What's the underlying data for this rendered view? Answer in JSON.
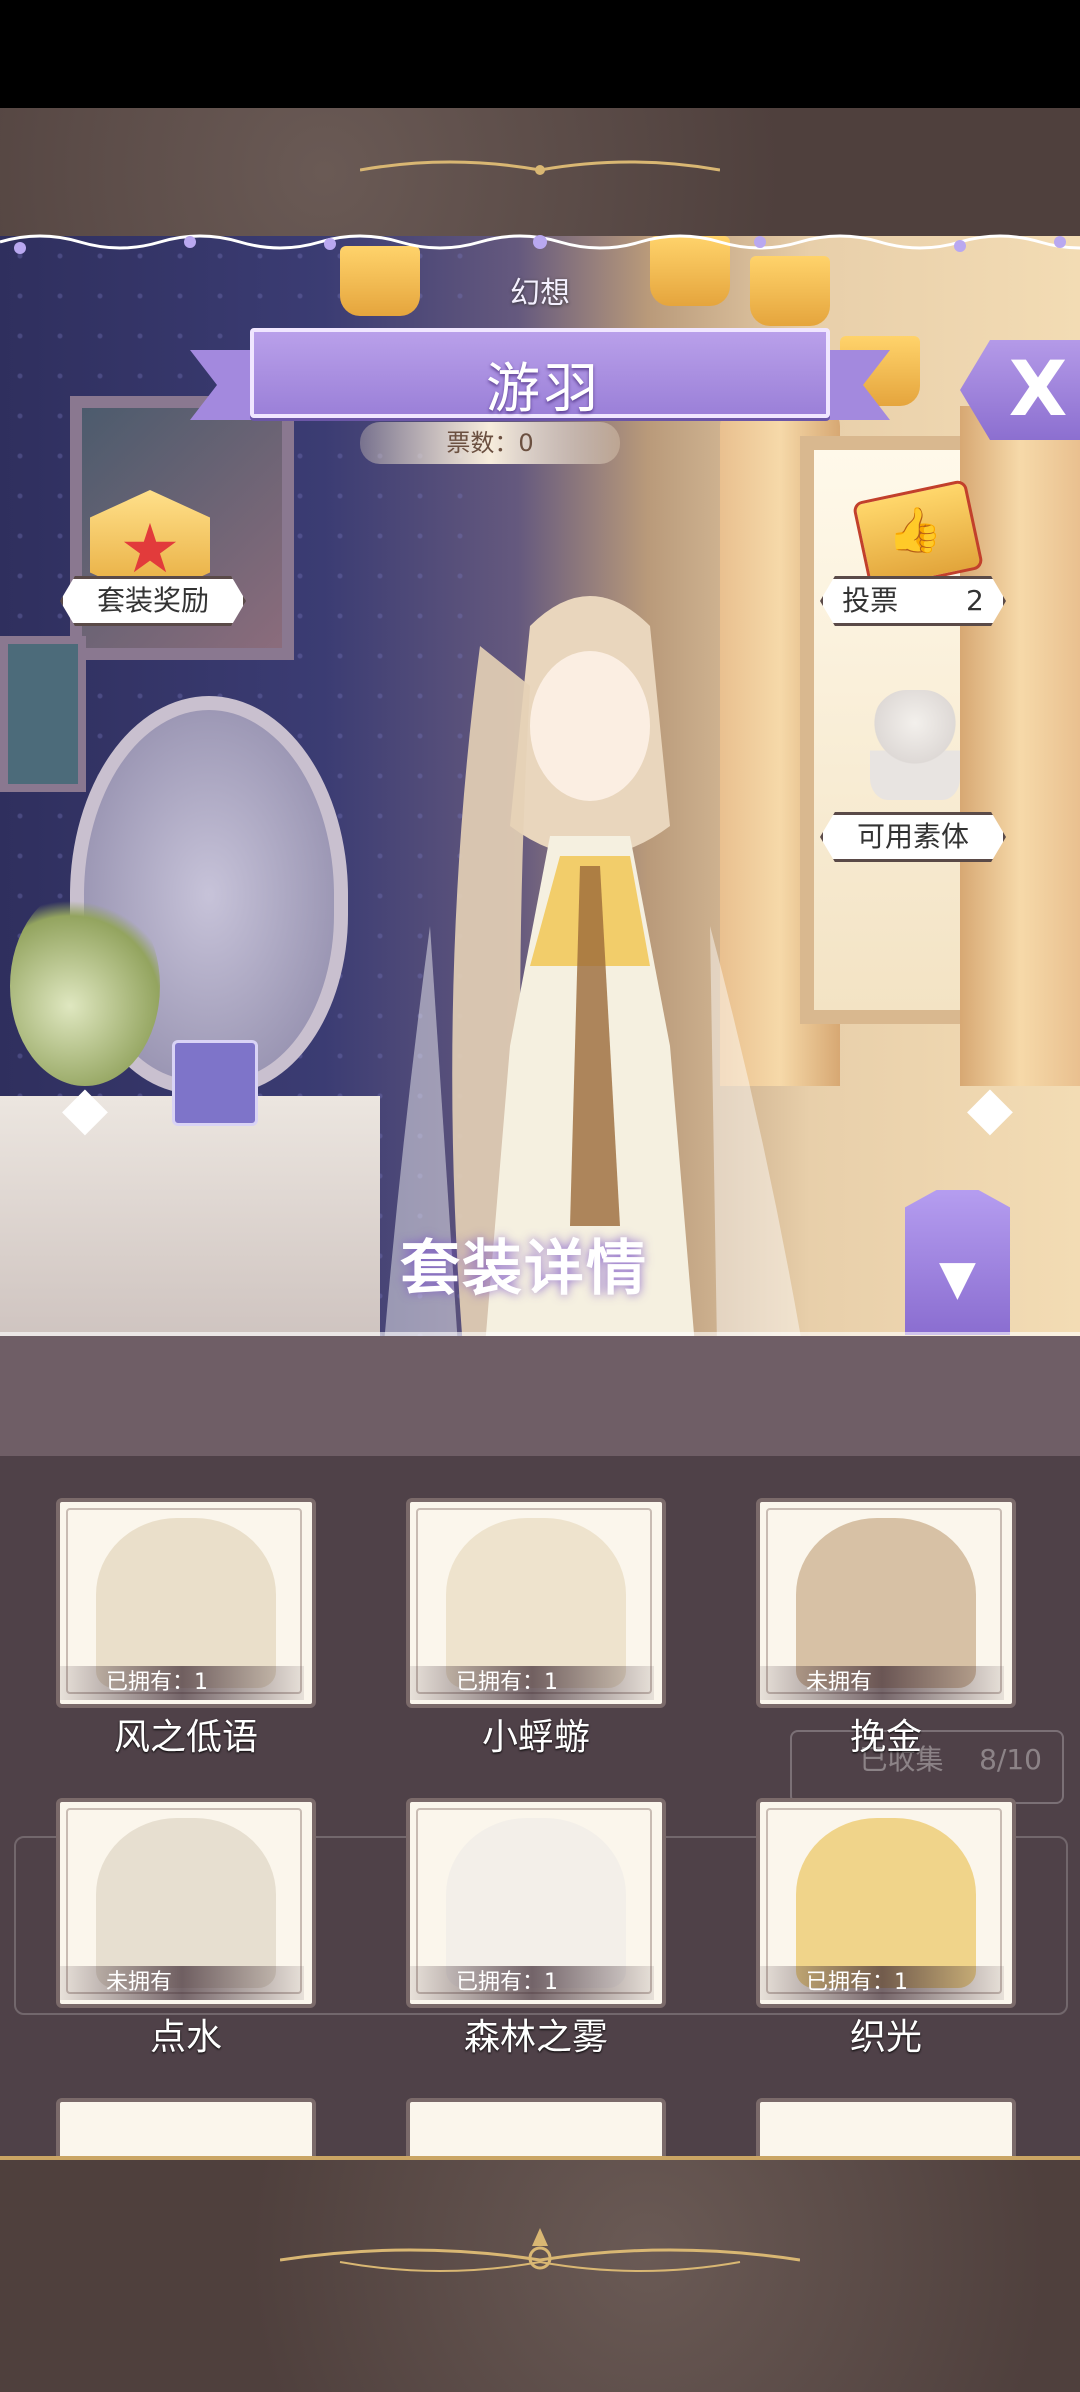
{
  "header": {
    "category": "幻想",
    "suit_name": "游羽",
    "votes_label": "票数：0"
  },
  "buttons": {
    "close": "X",
    "suit_reward": "套装奖励",
    "vote_label": "投票",
    "vote_count": "2",
    "available_mannequin": "可用素体",
    "prev_arrow": "◆",
    "next_arrow": "◆",
    "suit_details": "套装详情",
    "collapse": "▼"
  },
  "background_text": {
    "collected": "已收集",
    "progress": "8/10"
  },
  "items": [
    {
      "name": "风之低语",
      "ownership": "已拥有：1",
      "art_color": "#eadfca"
    },
    {
      "name": "小蜉蝣",
      "ownership": "已拥有：1",
      "art_color": "#eee3cd"
    },
    {
      "name": "挽金",
      "ownership": "未拥有",
      "art_color": "#d7c1a5"
    },
    {
      "name": "点水",
      "ownership": "未拥有",
      "art_color": "#e7dfd0"
    },
    {
      "name": "森林之雾",
      "ownership": "已拥有：1",
      "art_color": "#f3efe9"
    },
    {
      "name": "织光",
      "ownership": "已拥有：1",
      "art_color": "#f0d48a"
    }
  ],
  "colors": {
    "accent_purple": "#9b80d8",
    "frame_brown": "#4f403d",
    "gold": "#caa564"
  }
}
